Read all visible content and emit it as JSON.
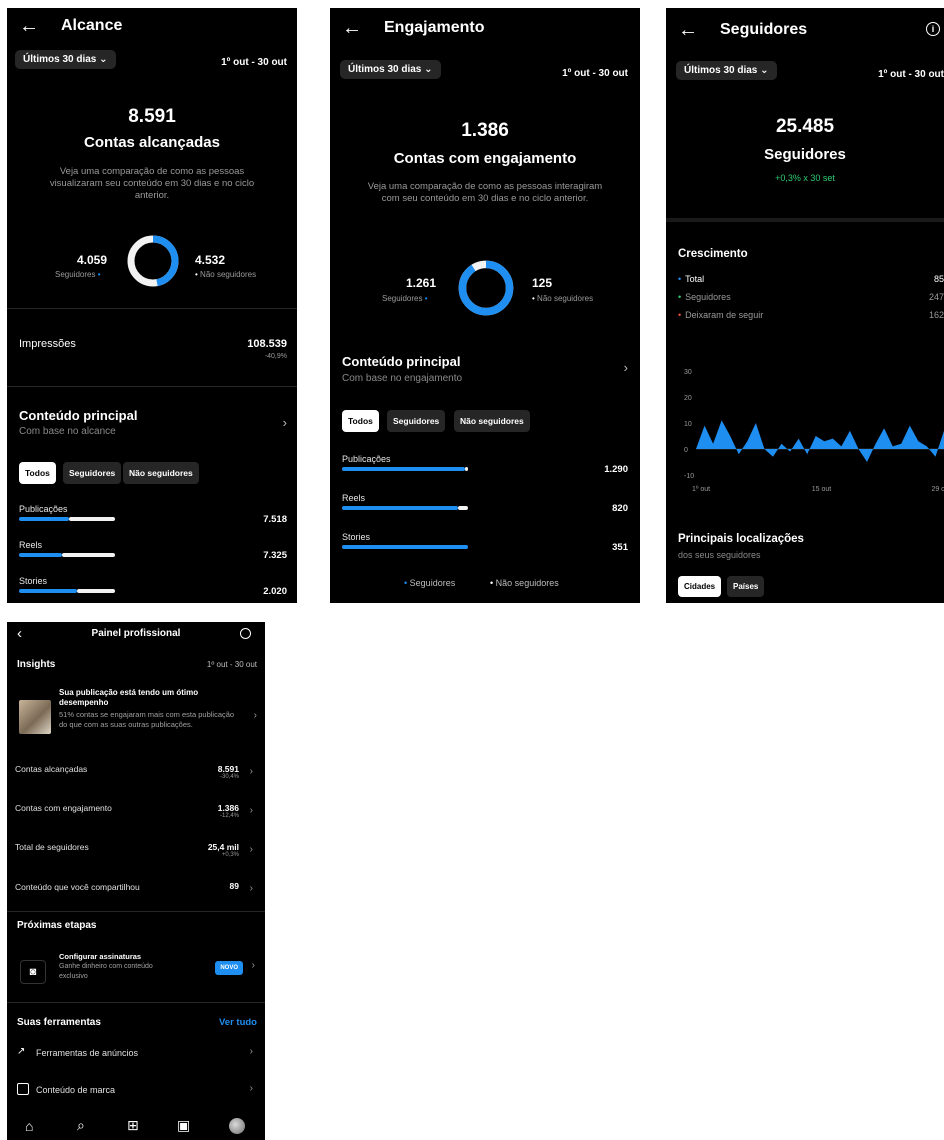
{
  "alcance": {
    "title": "Alcance",
    "period": "Últimos 30 dias ⌄",
    "date_range": "1º out - 30 out",
    "total": "8.591",
    "total_label": "Contas alcançadas",
    "description": "Veja uma comparação de como as pessoas visualizaram seu conteúdo em 30 dias e no ciclo anterior.",
    "followers_value": "4.059",
    "followers_label": "Seguidores",
    "nonfollowers_value": "4.532",
    "nonfollowers_label": "Não seguidores",
    "donut_followers_fraction": 0.47,
    "impressions_label": "Impressões",
    "impressions_value": "108.539",
    "impressions_change": "-40,9%",
    "content_title": "Conteúdo principal",
    "content_sub": "Com base no alcance",
    "tabs": [
      "Todos",
      "Seguidores",
      "Não seguidores"
    ],
    "rows": [
      {
        "label": "Publicações",
        "value": "7.518",
        "followers": 0.52,
        "nonfollowers": 0.48
      },
      {
        "label": "Reels",
        "value": "7.325",
        "followers": 0.45,
        "nonfollowers": 0.55
      },
      {
        "label": "Stories",
        "value": "2.020",
        "followers": 0.6,
        "nonfollowers": 0.4
      }
    ]
  },
  "engajamento": {
    "title": "Engajamento",
    "period": "Últimos 30 dias ⌄",
    "date_range": "1º out - 30 out",
    "total": "1.386",
    "total_label": "Contas com engajamento",
    "description": "Veja uma comparação de como as pessoas interagiram com seu conteúdo em 30 dias e no ciclo anterior.",
    "followers_value": "1.261",
    "followers_label": "Seguidores",
    "nonfollowers_value": "125",
    "nonfollowers_label": "Não seguidores",
    "donut_followers_fraction": 0.91,
    "content_title": "Conteúdo principal",
    "content_sub": "Com base no engajamento",
    "tabs": [
      "Todos",
      "Seguidores",
      "Não seguidores"
    ],
    "rows": [
      {
        "label": "Publicações",
        "value": "1.290",
        "followers": 0.98,
        "nonfollowers": 0.02
      },
      {
        "label": "Reels",
        "value": "820",
        "followers": 0.92,
        "nonfollowers": 0.08
      },
      {
        "label": "Stories",
        "value": "351",
        "followers": 1.0,
        "nonfollowers": 0.0
      }
    ],
    "legend_followers": "Seguidores",
    "legend_nonfollowers": "Não seguidores"
  },
  "seguidores": {
    "title": "Seguidores",
    "period": "Últimos 30 dias ⌄",
    "date_range": "1º out - 30 out",
    "total": "25.485",
    "total_label": "Seguidores",
    "change": "+0,3% x 30 set",
    "growth_title": "Crescimento",
    "growth_items": [
      {
        "label": "Total",
        "value": "85",
        "color": "#1f8ef1"
      },
      {
        "label": "Seguidores",
        "value": "247",
        "color": "#2ecc71"
      },
      {
        "label": "Deixaram de seguir",
        "value": "162",
        "color": "#e74c3c"
      }
    ],
    "locations_title": "Principais localizações",
    "locations_sub": "dos seus seguidores",
    "location_tabs": [
      "Cidades",
      "Países"
    ]
  },
  "chart_data": {
    "type": "area",
    "x": [
      1,
      2,
      3,
      4,
      5,
      6,
      7,
      8,
      9,
      10,
      11,
      12,
      13,
      14,
      15,
      16,
      17,
      18,
      19,
      20,
      21,
      22,
      23,
      24,
      25,
      26,
      27,
      28,
      29,
      30
    ],
    "x_tick_labels": [
      "1º out",
      "15 out",
      "29 out"
    ],
    "y_tick_labels": [
      "30",
      "20",
      "10",
      "0",
      "-10"
    ],
    "ylim": [
      -10,
      30
    ],
    "series": [
      {
        "values": [
          0,
          9,
          2,
          11,
          5,
          -2,
          3,
          10,
          0,
          -3,
          2,
          -1,
          4,
          -2,
          5,
          3,
          4,
          1,
          7,
          0,
          -5,
          2,
          8,
          1,
          2,
          9,
          3,
          1,
          -3,
          7
        ]
      }
    ]
  },
  "painel": {
    "title": "Painel profissional",
    "insights_title": "Insights",
    "date_range": "1º out - 30 out",
    "highlight_title": "Sua publicação está tendo um ótimo desempenho",
    "highlight_body": "51% contas se engajaram mais com esta publicação do que com as suas outras publicações.",
    "metrics": [
      {
        "label": "Contas alcançadas",
        "value": "8.591",
        "change": "-30,4%"
      },
      {
        "label": "Contas com engajamento",
        "value": "1.386",
        "change": "-12,4%"
      },
      {
        "label": "Total de seguidores",
        "value": "25,4 mil",
        "change": "+0,3%"
      },
      {
        "label": "Conteúdo que você compartilhou",
        "value": "89",
        "change": ""
      }
    ],
    "next_steps_title": "Próximas etapas",
    "subscription_title": "Configurar assinaturas",
    "subscription_body": "Ganhe dinheiro com conteúdo exclusivo",
    "new_badge": "NOVO",
    "tools_title": "Suas ferramentas",
    "see_all": "Ver tudo",
    "tools": [
      "Ferramentas de anúncios",
      "Conteúdo de marca"
    ]
  }
}
